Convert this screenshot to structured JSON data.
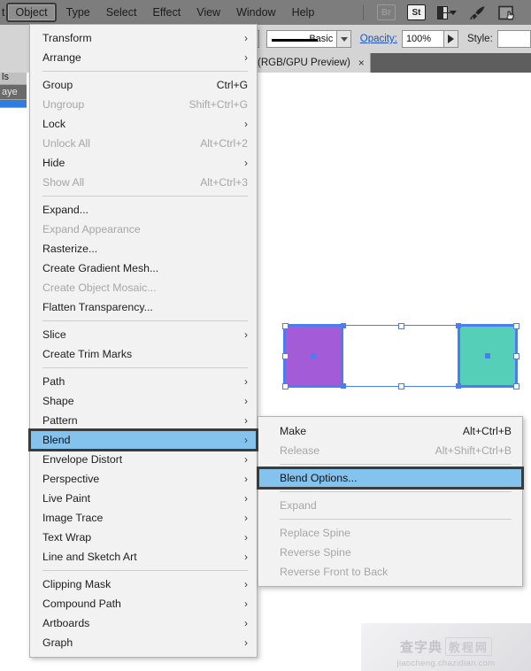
{
  "app": {
    "menubar": {
      "partial_left_item": "t",
      "items": [
        {
          "label": "Object",
          "active": true
        },
        {
          "label": "Type",
          "active": false
        },
        {
          "label": "Select",
          "active": false
        },
        {
          "label": "Effect",
          "active": false
        },
        {
          "label": "View",
          "active": false
        },
        {
          "label": "Window",
          "active": false
        },
        {
          "label": "Help",
          "active": false
        }
      ],
      "icons": [
        {
          "name": "bridge-icon",
          "label": "Br"
        },
        {
          "name": "adobe-stock-icon",
          "label": "St"
        },
        {
          "name": "arrange-documents-icon",
          "label": ""
        },
        {
          "name": "discover-rocket-icon",
          "label": ""
        },
        {
          "name": "touch-workspace-icon",
          "label": ""
        }
      ]
    },
    "options_bar": {
      "stroke_profile_label": "Basic",
      "opacity_label": "Opacity:",
      "opacity_value": "100%",
      "style_label": "Style:"
    },
    "document_tab": {
      "title": "(RGB/GPU Preview)",
      "close_label": "×"
    },
    "left_panel_strip": {
      "rows": [
        "?",
        "ls",
        "aye"
      ]
    }
  },
  "object_menu": {
    "name": "Object",
    "items": [
      {
        "label": "Transform",
        "accel": "",
        "arrow": true,
        "disabled": false
      },
      {
        "label": "Arrange",
        "accel": "",
        "arrow": true,
        "disabled": false
      },
      {
        "separator": true
      },
      {
        "label": "Group",
        "accel": "Ctrl+G",
        "arrow": false,
        "disabled": false
      },
      {
        "label": "Ungroup",
        "accel": "Shift+Ctrl+G",
        "arrow": false,
        "disabled": true
      },
      {
        "label": "Lock",
        "accel": "",
        "arrow": true,
        "disabled": false
      },
      {
        "label": "Unlock All",
        "accel": "Alt+Ctrl+2",
        "arrow": false,
        "disabled": true
      },
      {
        "label": "Hide",
        "accel": "",
        "arrow": true,
        "disabled": false
      },
      {
        "label": "Show All",
        "accel": "Alt+Ctrl+3",
        "arrow": false,
        "disabled": true
      },
      {
        "separator": true
      },
      {
        "label": "Expand...",
        "accel": "",
        "arrow": false,
        "disabled": false
      },
      {
        "label": "Expand Appearance",
        "accel": "",
        "arrow": false,
        "disabled": true
      },
      {
        "label": "Rasterize...",
        "accel": "",
        "arrow": false,
        "disabled": false
      },
      {
        "label": "Create Gradient Mesh...",
        "accel": "",
        "arrow": false,
        "disabled": false
      },
      {
        "label": "Create Object Mosaic...",
        "accel": "",
        "arrow": false,
        "disabled": true
      },
      {
        "label": "Flatten Transparency...",
        "accel": "",
        "arrow": false,
        "disabled": false
      },
      {
        "separator": true
      },
      {
        "label": "Slice",
        "accel": "",
        "arrow": true,
        "disabled": false
      },
      {
        "label": "Create Trim Marks",
        "accel": "",
        "arrow": false,
        "disabled": false
      },
      {
        "separator": true
      },
      {
        "label": "Path",
        "accel": "",
        "arrow": true,
        "disabled": false
      },
      {
        "label": "Shape",
        "accel": "",
        "arrow": true,
        "disabled": false
      },
      {
        "label": "Pattern",
        "accel": "",
        "arrow": true,
        "disabled": false
      },
      {
        "label": "Blend",
        "accel": "",
        "arrow": true,
        "disabled": false,
        "highlighted": true
      },
      {
        "label": "Envelope Distort",
        "accel": "",
        "arrow": true,
        "disabled": false
      },
      {
        "label": "Perspective",
        "accel": "",
        "arrow": true,
        "disabled": false
      },
      {
        "label": "Live Paint",
        "accel": "",
        "arrow": true,
        "disabled": false
      },
      {
        "label": "Image Trace",
        "accel": "",
        "arrow": true,
        "disabled": false
      },
      {
        "label": "Text Wrap",
        "accel": "",
        "arrow": true,
        "disabled": false
      },
      {
        "label": "Line and Sketch Art",
        "accel": "",
        "arrow": true,
        "disabled": false
      },
      {
        "separator": true
      },
      {
        "label": "Clipping Mask",
        "accel": "",
        "arrow": true,
        "disabled": false
      },
      {
        "label": "Compound Path",
        "accel": "",
        "arrow": true,
        "disabled": false
      },
      {
        "label": "Artboards",
        "accel": "",
        "arrow": true,
        "disabled": false
      },
      {
        "label": "Graph",
        "accel": "",
        "arrow": true,
        "disabled": false
      }
    ]
  },
  "blend_submenu": {
    "name": "Blend",
    "items": [
      {
        "label": "Make",
        "accel": "Alt+Ctrl+B",
        "disabled": false
      },
      {
        "label": "Release",
        "accel": "Alt+Shift+Ctrl+B",
        "disabled": true
      },
      {
        "separator": true
      },
      {
        "label": "Blend Options...",
        "accel": "",
        "disabled": false,
        "highlighted": true
      },
      {
        "separator": true
      },
      {
        "label": "Expand",
        "accel": "",
        "disabled": true
      },
      {
        "separator": true
      },
      {
        "label": "Replace Spine",
        "accel": "",
        "disabled": true
      },
      {
        "label": "Reverse Spine",
        "accel": "",
        "disabled": true
      },
      {
        "label": "Reverse Front to Back",
        "accel": "",
        "disabled": true
      }
    ]
  },
  "canvas": {
    "selection": {
      "objects": [
        {
          "name": "left-square",
          "fill": "#a45bd8"
        },
        {
          "name": "right-square",
          "fill": "#55cfb8"
        }
      ],
      "stroke_color": "#4a7df0"
    }
  },
  "watermark": {
    "cn_text": "查字典",
    "cn_text_2": "教程网",
    "url": "jiaocheng.chazidian.com"
  },
  "colors": {
    "menubar_bg": "#7d7d7d",
    "menu_bg": "#f2f2f2",
    "highlight": "#85c3ef",
    "focus_ring": "#3b3b3b",
    "accent_blue": "#4a7df0"
  }
}
